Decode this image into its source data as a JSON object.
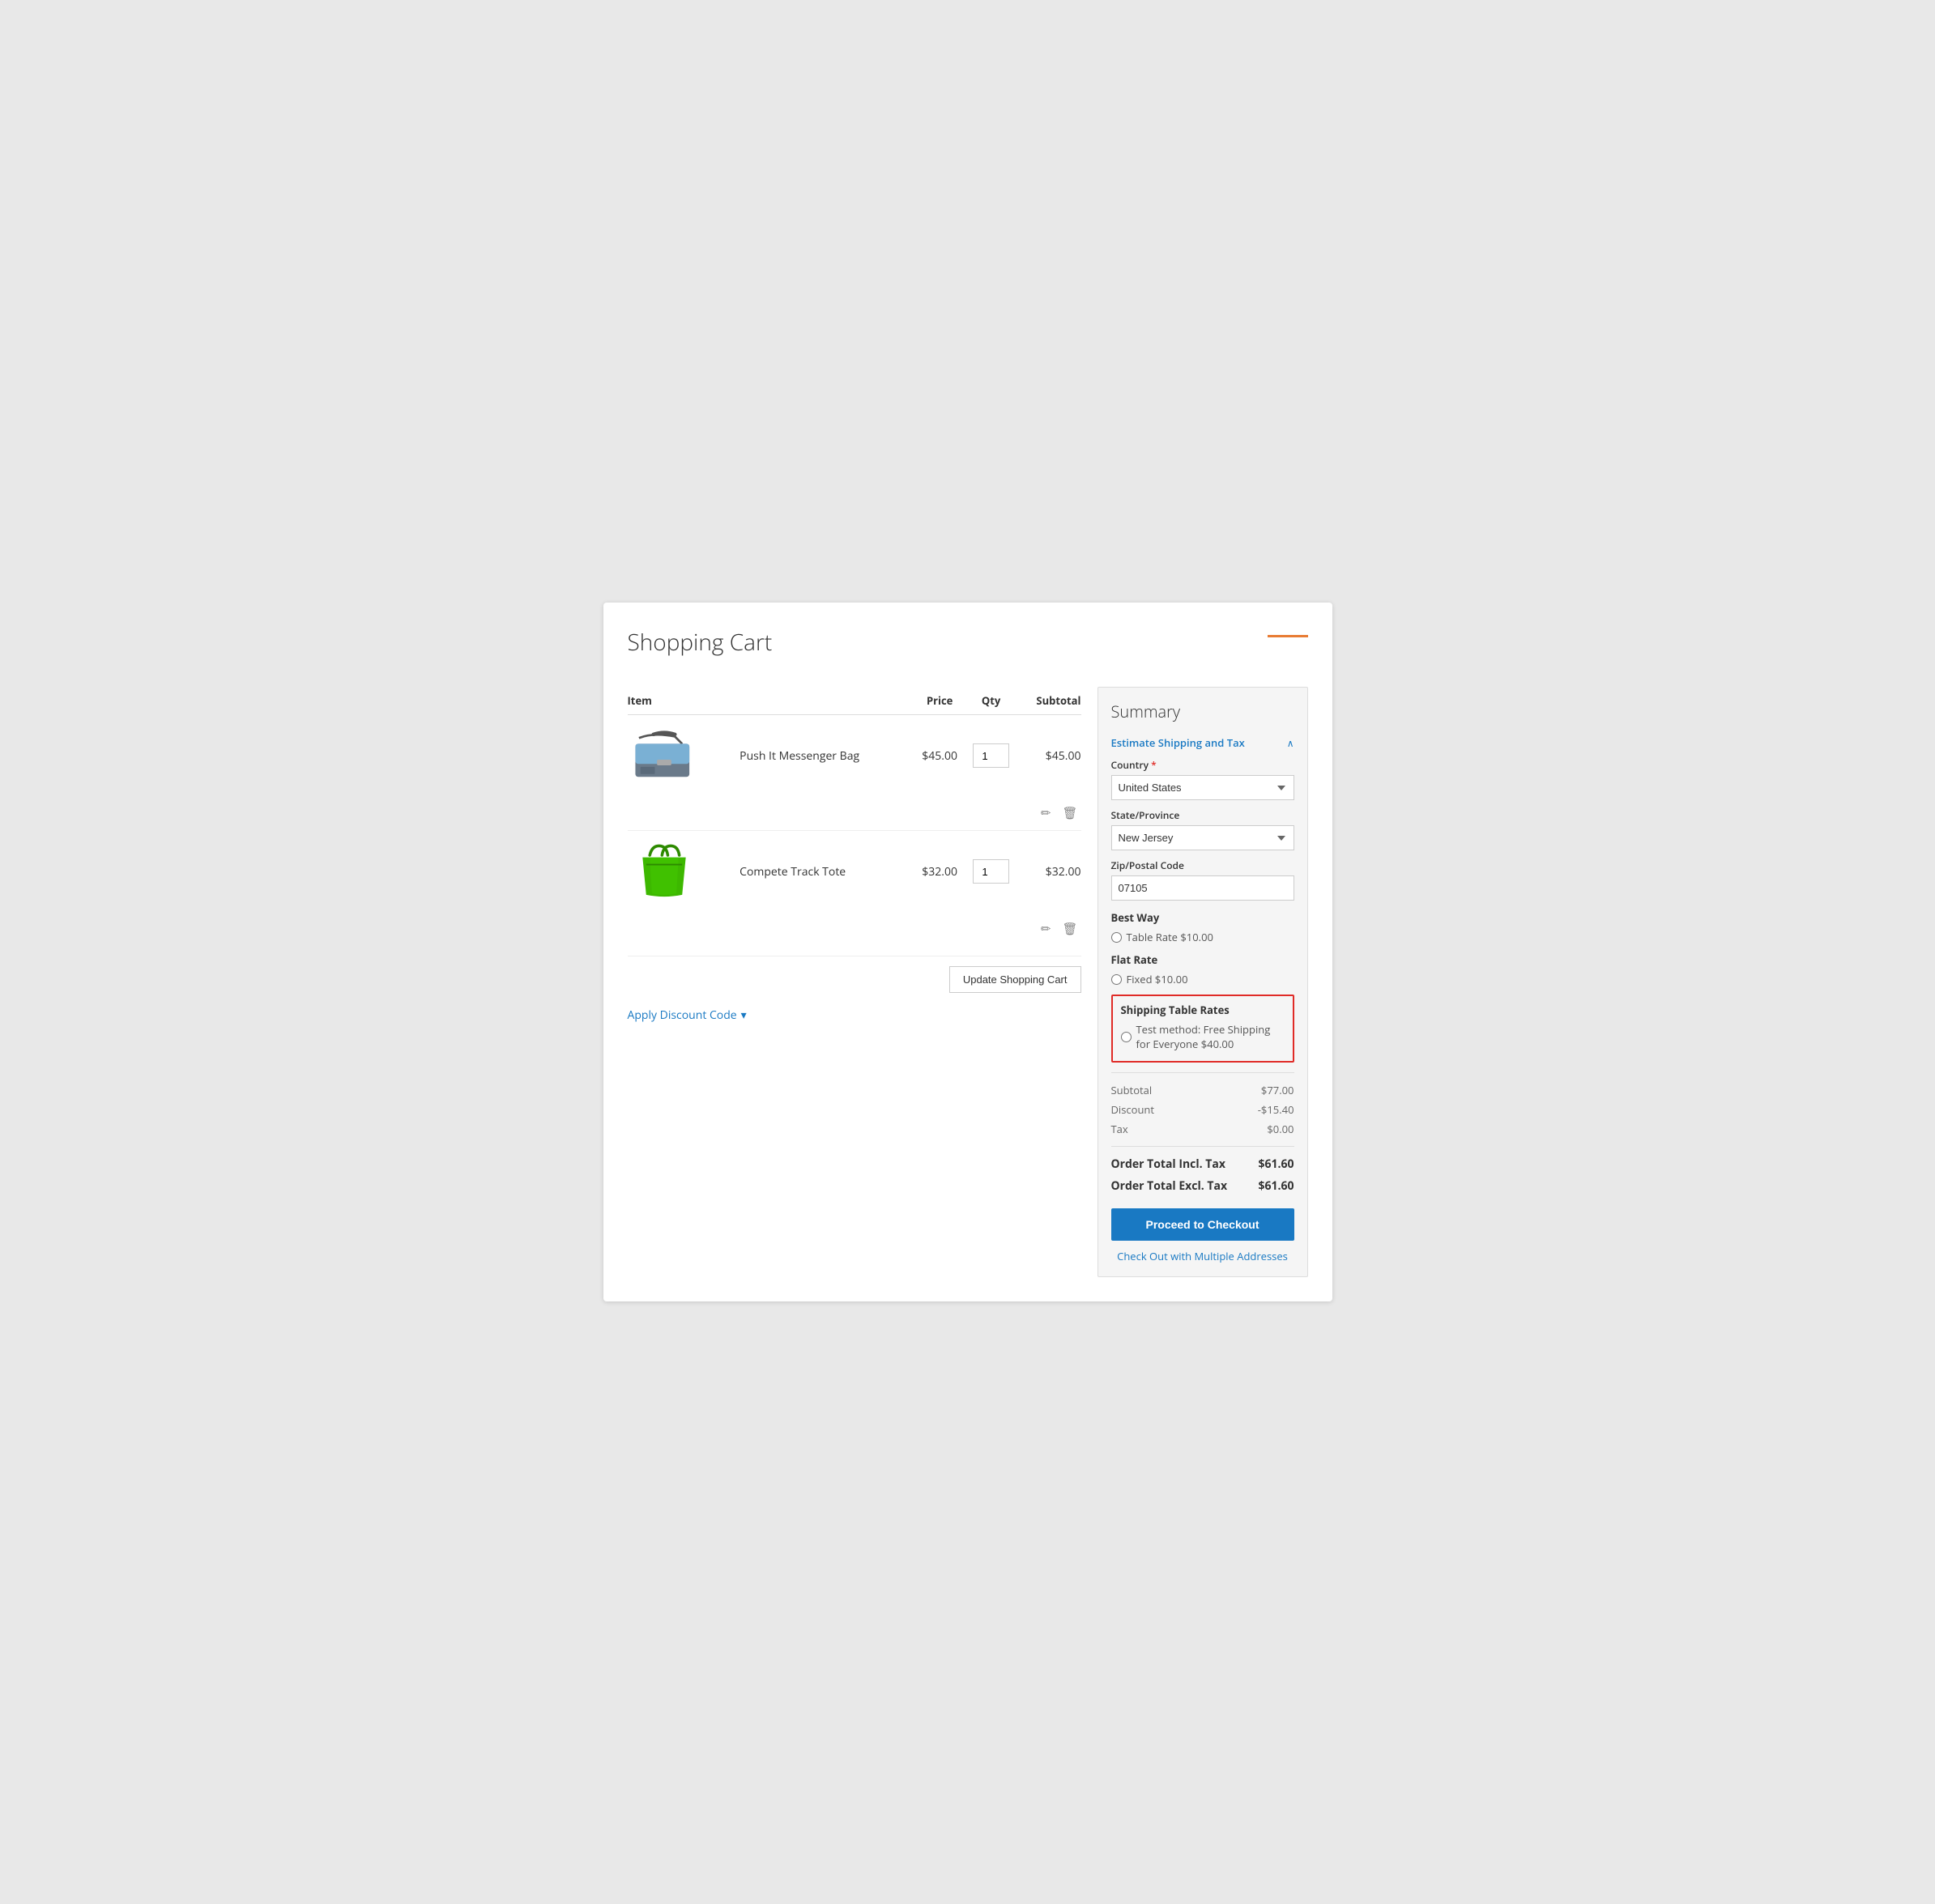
{
  "page": {
    "title": "Shopping Cart"
  },
  "table": {
    "headers": {
      "item": "Item",
      "price": "Price",
      "qty": "Qty",
      "subtotal": "Subtotal"
    }
  },
  "items": [
    {
      "id": "item-1",
      "name": "Push It Messenger Bag",
      "price": "$45.00",
      "qty": "1",
      "subtotal": "$45.00",
      "image_type": "messenger"
    },
    {
      "id": "item-2",
      "name": "Compete Track Tote",
      "price": "$32.00",
      "qty": "1",
      "subtotal": "$32.00",
      "image_type": "tote"
    }
  ],
  "buttons": {
    "update_cart": "Update Shopping Cart",
    "apply_discount": "Apply Discount Code",
    "checkout": "Proceed to Checkout",
    "multi_address": "Check Out with Multiple Addresses"
  },
  "summary": {
    "title": "Summary",
    "estimate_section": "Estimate Shipping and Tax",
    "country_label": "Country",
    "country_required": true,
    "country_value": "United States",
    "state_label": "State/Province",
    "state_value": "New Jersey",
    "zip_label": "Zip/Postal Code",
    "zip_value": "07105",
    "shipping_groups": [
      {
        "name": "Best Way",
        "options": [
          {
            "label": "Table Rate $10.00",
            "selected": false
          }
        ]
      },
      {
        "name": "Flat Rate",
        "options": [
          {
            "label": "Fixed $10.00",
            "selected": false
          }
        ]
      },
      {
        "name": "Shipping Table Rates",
        "highlighted": true,
        "options": [
          {
            "label": "Test method: Free Shipping for Everyone $40.00",
            "selected": false
          }
        ]
      }
    ],
    "totals": {
      "subtotal_label": "Subtotal",
      "subtotal_value": "$77.00",
      "discount_label": "Discount",
      "discount_value": "-$15.40",
      "tax_label": "Tax",
      "tax_value": "$0.00",
      "order_total_incl_label": "Order Total Incl. Tax",
      "order_total_incl_value": "$61.60",
      "order_total_excl_label": "Order Total Excl. Tax",
      "order_total_excl_value": "$61.60"
    }
  }
}
